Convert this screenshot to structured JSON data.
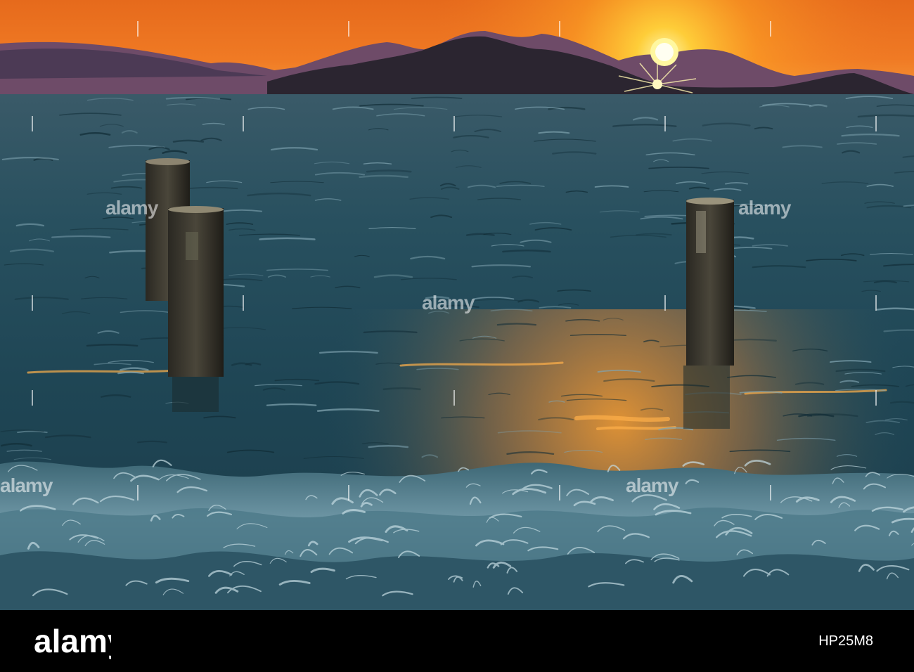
{
  "photo": {
    "subject": "Sunset over the sea with mountains, three wooden pier posts in the water and waves breaking in the foreground",
    "colors": {
      "sky_top": "#e86a1e",
      "sky_glow": "#ffb11a",
      "sun": "#ffe86a",
      "mountains_far": "#6d4a66",
      "mountains_near": "#2d2733",
      "water_deep": "#1b3e4c",
      "water_mid": "#2c5866",
      "reflection": "#ff9a2a",
      "foam": "#8fb3c0",
      "posts": "#2e2a24"
    }
  },
  "watermark": {
    "text": "alamy",
    "icon": "alamy-watermark"
  },
  "footer": {
    "brand": "alamy",
    "image_id": "HP25M8"
  }
}
